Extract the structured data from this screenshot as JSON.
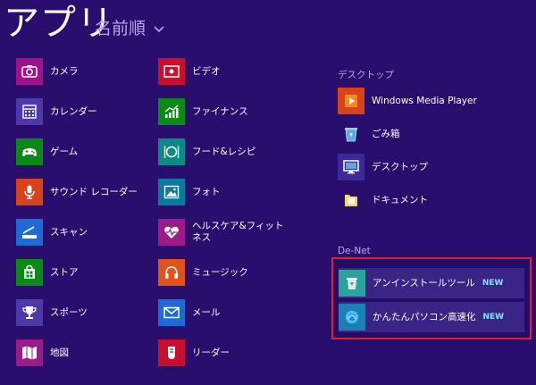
{
  "header": {
    "title": "アプリ",
    "sort_label": "名前順"
  },
  "apps_col1": [
    {
      "label": "カメラ",
      "color": "#a0128a",
      "icon": "camera-icon"
    },
    {
      "label": "カレンダー",
      "color": "#4b3aa8",
      "icon": "calendar-icon"
    },
    {
      "label": "ゲーム",
      "color": "#0b8a18",
      "icon": "gamepad-icon"
    },
    {
      "label": "サウンド レコーダー",
      "color": "#d8431b",
      "icon": "microphone-icon"
    },
    {
      "label": "スキャン",
      "color": "#1f6bd6",
      "icon": "scanner-icon"
    },
    {
      "label": "ストア",
      "color": "#0b8a18",
      "icon": "store-icon"
    },
    {
      "label": "スポーツ",
      "color": "#4b3aa8",
      "icon": "trophy-icon"
    },
    {
      "label": "地図",
      "color": "#9b1b8a",
      "icon": "map-icon"
    }
  ],
  "apps_col2": [
    {
      "label": "ビデオ",
      "color": "#c8102e",
      "icon": "video-icon"
    },
    {
      "label": "ファイナンス",
      "color": "#0b8a18",
      "icon": "chart-icon"
    },
    {
      "label": "フード&レシピ",
      "color": "#0b8a88",
      "icon": "dining-icon"
    },
    {
      "label": "フォト",
      "color": "#0b7a9e",
      "icon": "photo-icon"
    },
    {
      "label": "ヘルスケア&フィットネス",
      "color": "#9b1b8a",
      "icon": "heart-pulse-icon"
    },
    {
      "label": "ミュージック",
      "color": "#e0541b",
      "icon": "headphones-icon"
    },
    {
      "label": "メール",
      "color": "#1f6bd6",
      "icon": "mail-icon"
    },
    {
      "label": "リーダー",
      "color": "#c8102e",
      "icon": "reader-icon"
    }
  ],
  "desktop": {
    "title": "デスクトップ",
    "items": [
      {
        "label": "Windows Media Player",
        "icon": "media-player-icon"
      },
      {
        "label": "ごみ箱",
        "icon": "recycle-bin-icon"
      },
      {
        "label": "デスクトップ",
        "icon": "desktop-icon"
      },
      {
        "label": "ドキュメント",
        "icon": "folder-icon"
      }
    ]
  },
  "denet": {
    "title": "De-Net",
    "items": [
      {
        "label": "アンインストールツール",
        "badge": "NEW",
        "icon": "uninstall-tool-icon"
      },
      {
        "label": "かんたんパソコン高速化",
        "badge": "NEW",
        "icon": "pc-speedup-icon"
      }
    ]
  }
}
